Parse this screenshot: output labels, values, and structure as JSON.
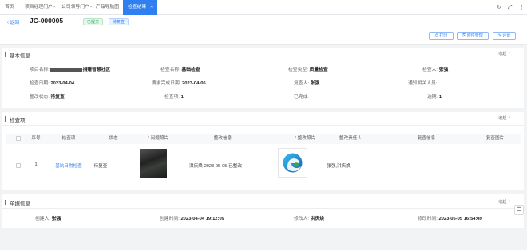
{
  "tabs": [
    {
      "label": "首页",
      "close": ""
    },
    {
      "label": "项目经理门户",
      "close": "×"
    },
    {
      "label": "公司领导门户",
      "close": "×"
    },
    {
      "label": "产品导航图",
      "close": ""
    },
    {
      "label": "检查结果",
      "close": "×"
    }
  ],
  "toolbar": {
    "refresh": "↻",
    "maximize": "⤢",
    "more": "⋮"
  },
  "header": {
    "back": "返回",
    "doc_no": "JC-000005",
    "badge_submitted": "已提交",
    "badge_pending": "待复查",
    "btn_print": "打印",
    "btn_attachment": "附件管理",
    "btn_comment": "评论"
  },
  "basic": {
    "title": "基本信息",
    "collapse": "收起",
    "project_label": "项目名称:",
    "project_value": "捐赠智慧社区",
    "check_name_label": "检查名称:",
    "check_name_value": "基础检查",
    "check_type_label": "检查类型:",
    "check_type_value": "质量检查",
    "inspector_label": "检查人:",
    "inspector_value": "张强",
    "check_date_label": "检查日期:",
    "check_date_value": "2023-04-04",
    "deadline_label": "要求完成日期:",
    "deadline_value": "2023-04-06",
    "reviewer_label": "复查人:",
    "reviewer_value": "张强",
    "notify_label": "通知相关人员:",
    "notify_value": "",
    "status_label": "整改状态:",
    "status_value": "待复查",
    "check_item_label": "检查项:",
    "check_item_value": "1",
    "completed_label": "已完成:",
    "completed_value": "",
    "overdue_label": "逾期:",
    "overdue_value": "1"
  },
  "items": {
    "title": "检查项",
    "collapse": "收起",
    "columns": [
      "序号",
      "检查项",
      "状态",
      "问题照片",
      "整改信息",
      "整改照片",
      "整改责任人",
      "复查信息",
      "复查图片"
    ],
    "rows": [
      {
        "index": "1",
        "item": "基坑日常检查",
        "status": "待复查",
        "rectify_info": "洪庆焕-2023-05-05-已整改",
        "owner": "张强,洪庆焕",
        "review_info": "",
        "review_image": ""
      }
    ]
  },
  "doc_info": {
    "title": "单据信息",
    "collapse": "收起",
    "creator_label": "创建人:",
    "creator_value": "张强",
    "created_label": "创建时间:",
    "created_value": "2023-04-04 19:12:09",
    "modifier_label": "修改人:",
    "modifier_value": "洪庆焕",
    "modified_label": "修改时间:",
    "modified_value": "2023-05-05 16:54:49"
  },
  "colors": {
    "accent": "#2f7ff0",
    "success": "#2fae5c",
    "required": "#e34d59"
  }
}
